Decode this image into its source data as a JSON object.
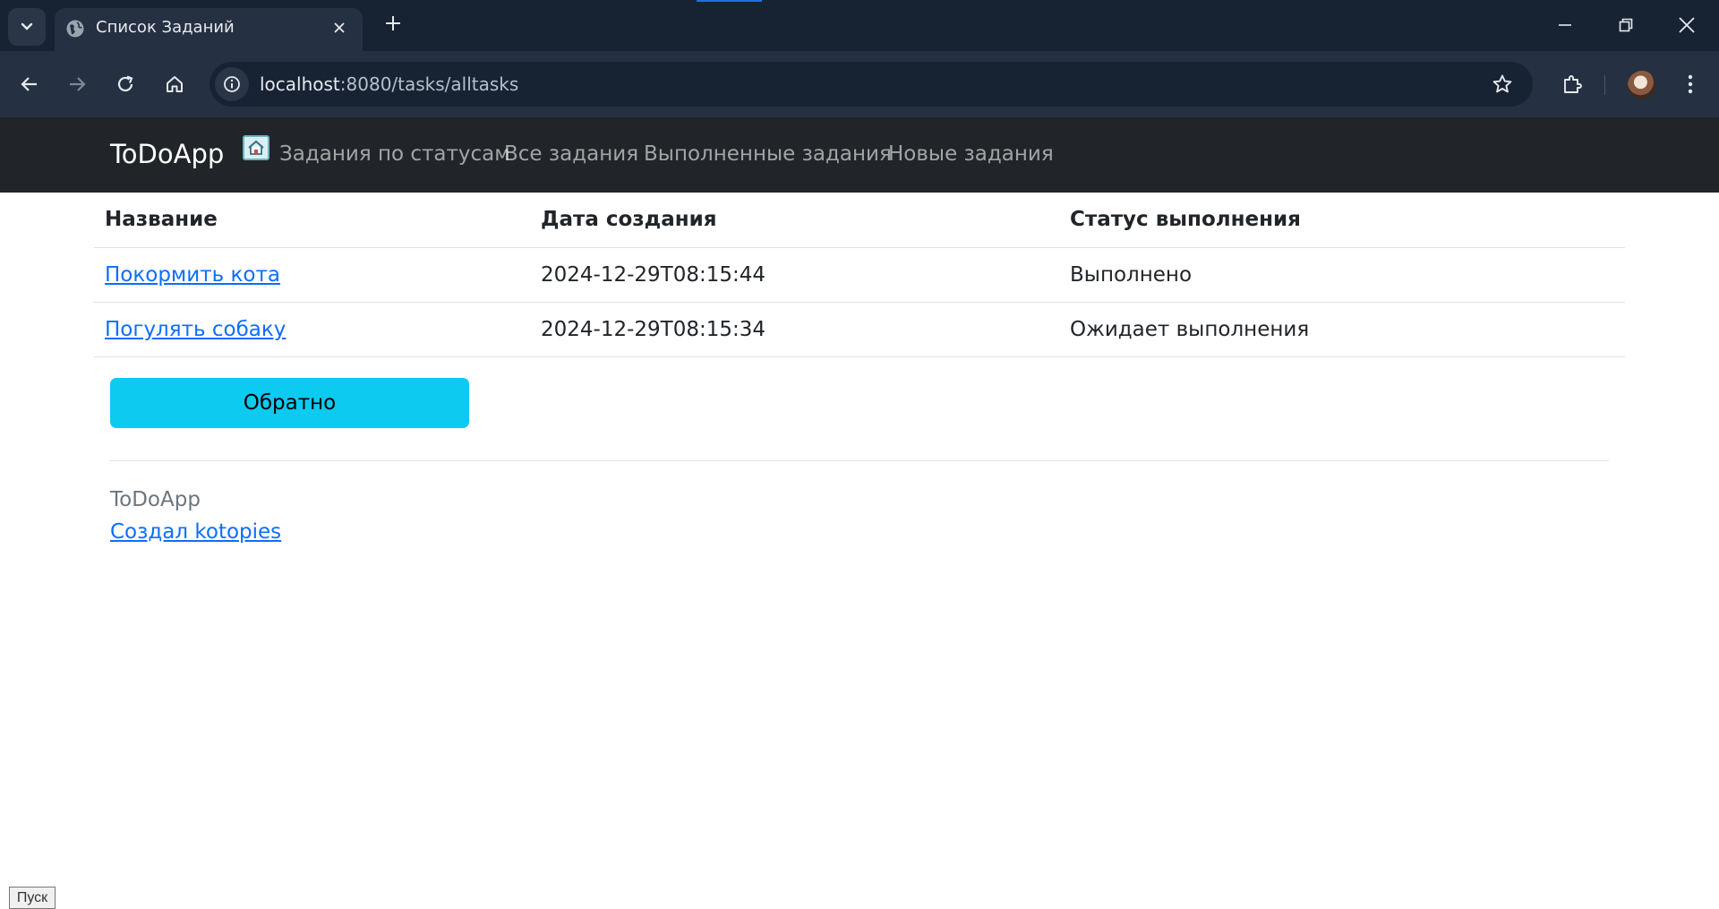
{
  "browser": {
    "tab_title": "Список Заданий",
    "url_host": "localhost",
    "url_path": ":8080/tasks/alltasks",
    "icons": {
      "tab_search": "chevron-down-icon",
      "favicon": "globe-icon",
      "tab_close": "close-icon",
      "new_tab": "plus-icon",
      "minimize": "minimize-icon",
      "restore": "restore-icon",
      "close_window": "close-icon",
      "back": "arrow-left-icon",
      "forward": "arrow-right-icon",
      "reload": "reload-icon",
      "home": "home-icon",
      "site_info": "info-icon",
      "bookmark": "star-icon",
      "extensions": "puzzle-icon",
      "menu": "kebab-menu-icon"
    }
  },
  "navbar": {
    "brand": "ToDoApp",
    "links": [
      "Задания по статусам",
      "Все задания",
      "Выполненные задания",
      "Новые задания"
    ]
  },
  "table": {
    "headers": [
      "Название",
      "Дата создания",
      "Статус выполнения"
    ],
    "rows": [
      {
        "name": "Покормить кота",
        "created": "2024-12-29T08:15:44",
        "status": "Выполнено"
      },
      {
        "name": "Погулять собаку",
        "created": "2024-12-29T08:15:34",
        "status": "Ожидает выполнения"
      }
    ]
  },
  "back_button": "Обратно",
  "footer": {
    "brand": "ToDoApp",
    "author_link": "Создал kotopies"
  },
  "taskbar": {
    "start_label": "Пуск"
  },
  "colors": {
    "navbar_bg": "#212529",
    "link": "#0d6efd",
    "button_info": "#0dcaf0",
    "chrome_dark": "#172233",
    "chrome_toolbar": "#253142"
  }
}
